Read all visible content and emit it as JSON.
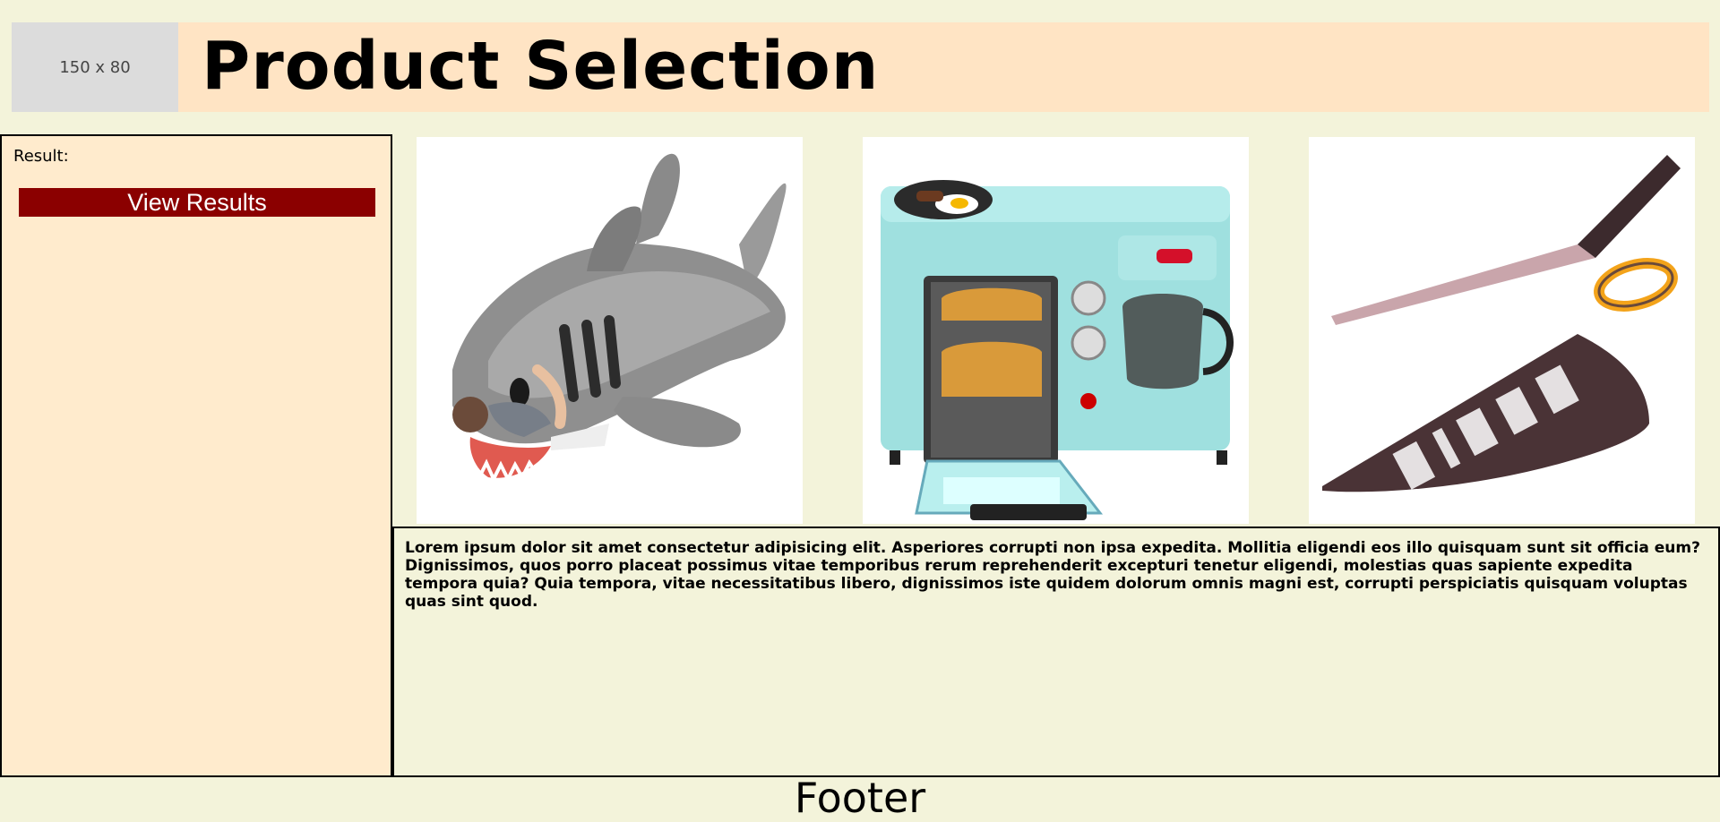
{
  "header": {
    "logo_placeholder": "150 x 80",
    "title": "Product Selection"
  },
  "sidebar": {
    "result_label": "Result:",
    "view_results_label": "View Results"
  },
  "products": [
    {
      "name": "shark-sleeping-bag"
    },
    {
      "name": "breakfast-station-toaster-oven"
    },
    {
      "name": "pizza-scissors"
    }
  ],
  "content": {
    "text": "Lorem ipsum dolor sit amet consectetur adipisicing elit. Asperiores corrupti non ipsa expedita. Mollitia eligendi eos illo quisquam sunt sit officia eum? Dignissimos, quos porro placeat possimus vitae temporibus rerum reprehenderit excepturi tenetur eligendi, molestias quas sapiente expedita tempora quia? Quia tempora, vitae necessitatibus libero, dignissimos iste quidem dolorum omnis magni est, corrupti perspiciatis quisquam voluptas quas sint quod."
  },
  "footer": {
    "text": "Footer"
  },
  "colors": {
    "page_bg": "#f3f3da",
    "header_bg": "#ffe4c4",
    "sidebar_bg": "#ffebcd",
    "button_bg": "#8b0000",
    "placeholder_bg": "#dcdcdc"
  }
}
